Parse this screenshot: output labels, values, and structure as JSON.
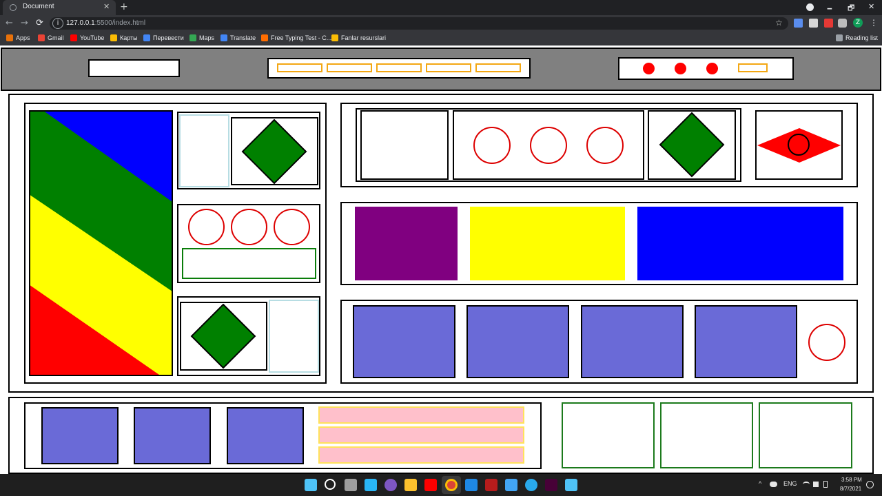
{
  "browser": {
    "tab_title": "Document",
    "tab_close": "✕",
    "new_tab": "+",
    "url_host": "127.0.0.1",
    "url_rest": ":5500/index.html",
    "win_minimize": "🗕",
    "win_restore": "🗗",
    "win_close": "✕",
    "back": "←",
    "forward": "→",
    "reload": "⟳",
    "info": "i",
    "star": "☆",
    "menu": "⋮",
    "profile_initial": "Z",
    "bookmarks": [
      {
        "label": "Apps",
        "color": "#e8710a"
      },
      {
        "label": "Gmail",
        "color": "#ea4335"
      },
      {
        "label": "YouTube",
        "color": "#ff0000"
      },
      {
        "label": "Карты",
        "color": "#fbbc04"
      },
      {
        "label": "Перевести",
        "color": "#4285f4"
      },
      {
        "label": "Maps",
        "color": "#34a853"
      },
      {
        "label": "Translate",
        "color": "#4285f4"
      },
      {
        "label": "Free Typing Test - C...",
        "color": "#ff6d00"
      },
      {
        "label": "Fanlar resurslari",
        "color": "#fbbc04"
      }
    ],
    "reading_list": "Reading list"
  },
  "page": {
    "colors": {
      "header_bg": "#808080",
      "blue": "#0000ff",
      "green": "#008000",
      "yellow": "#ffff00",
      "red": "#ff0000",
      "purple": "#800080",
      "periwinkle": "#6a6ad7",
      "pink": "#ffc0cb"
    }
  },
  "taskbar": {
    "language": "ENG",
    "time": "3:58 PM",
    "date": "8/7/2021",
    "caret": "^"
  }
}
